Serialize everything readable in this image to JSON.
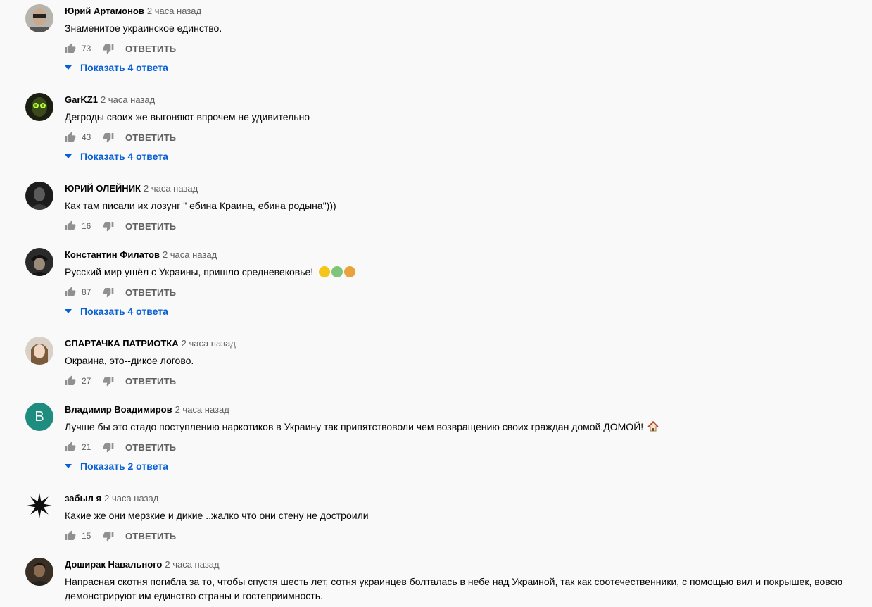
{
  "comments": [
    {
      "author": "Юрий Артамонов",
      "time": "2 часа назад",
      "text": "Знаменитое украинское единство.",
      "likes": "73",
      "reply_label": "ОТВЕТИТЬ",
      "replies_label": "Показать 4 ответа"
    },
    {
      "author": "GarKZ1",
      "time": "2 часа назад",
      "text": "Дегроды своих же выгоняют впрочем не удивительно",
      "likes": "43",
      "reply_label": "ОТВЕТИТЬ",
      "replies_label": "Показать 4 ответа"
    },
    {
      "author": "ЮРИЙ ОЛЕЙНИК",
      "time": "2 часа назад",
      "text": "Как там писали их лозунг \" ебина Краина, ебина родына\")))",
      "likes": "16",
      "reply_label": "ОТВЕТИТЬ"
    },
    {
      "author": "Константин Филатов",
      "time": "2 часа назад",
      "text": "Русский мир ушёл с Украины, пришло средневековье!",
      "likes": "87",
      "reply_label": "ОТВЕТИТЬ",
      "replies_label": "Показать 4 ответа"
    },
    {
      "author": "СПАРТАЧКА ПАТРИОТКА",
      "time": "2 часа назад",
      "text": "Окраина, это--дикое логово.",
      "likes": "27",
      "reply_label": "ОТВЕТИТЬ"
    },
    {
      "author": "Владимир Воадимиров",
      "time": "2 часа назад",
      "text": "Лучше бы это стадо поступлению наркотиков в Украину так припятствоволи чем возвращению своих граждан домой.ДОМОЙ!",
      "likes": "21",
      "reply_label": "ОТВЕТИТЬ",
      "replies_label": "Показать 2 ответа",
      "avatar_letter": "В"
    },
    {
      "author": "забыл я",
      "time": "2 часа назад",
      "text": "Какие же они мерзкие и дикие ..жалко что они стену не достроили",
      "likes": "15",
      "reply_label": "ОТВЕТИТЬ"
    },
    {
      "author": "Доширак Навального",
      "time": "2 часа назад",
      "text": "Напрасная скотня погибла за то, чтобы спустя шесть лет, сотня украинцев болталась в небе над Украиной, так как соотечественники, с помощью вил и покрышек, вовсю демонстрируют им единство страны и гостеприимность."
    }
  ],
  "colors": {
    "link": "#065fd4",
    "muted": "#606060",
    "text": "#030303",
    "letter_avatar": "#1e8c7e"
  },
  "icons": [
    "thumb-up-icon",
    "thumb-down-icon",
    "caret-down-icon",
    "emoji-icon",
    "house-emoji-icon"
  ]
}
